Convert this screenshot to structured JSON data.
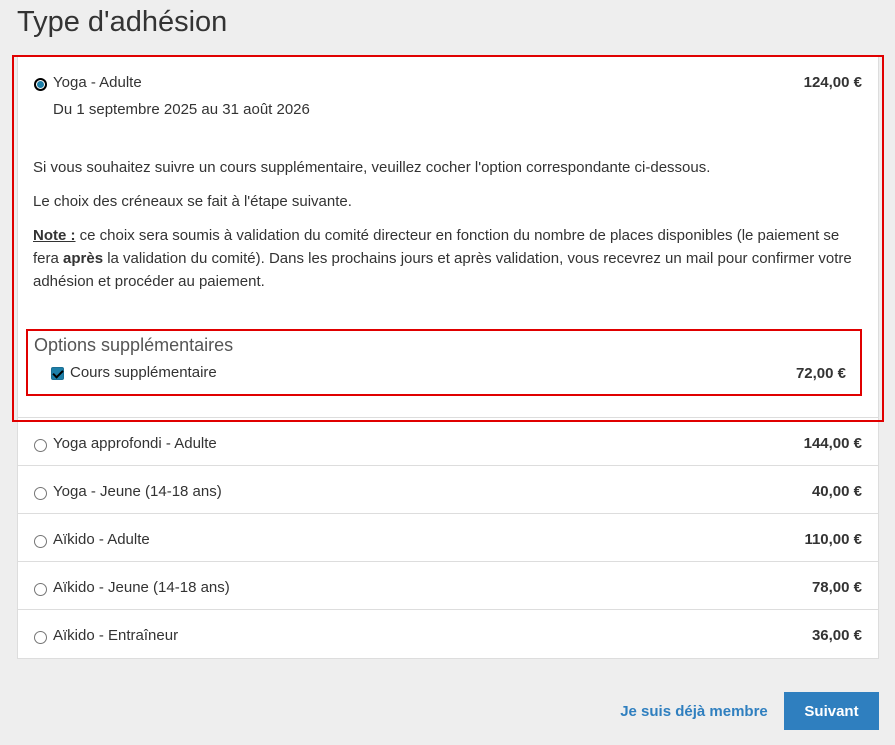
{
  "page": {
    "title": "Type d'adhésion"
  },
  "memberships": [
    {
      "label": "Yoga - Adulte",
      "price": "124,00 €",
      "selected": true,
      "dates": "Du 1 septembre 2025 au 31 août 2026",
      "description": {
        "line1": "Si vous souhaitez suivre un cours supplémentaire, veuillez cocher l'option correspondante ci-dessous.",
        "line2": "Le choix des créneaux se fait à l'étape suivante.",
        "note_label": "Note :",
        "note_text_1": " ce choix sera soumis à validation du comité directeur en fonction du nombre de places disponibles (le paiement se fera ",
        "note_bold": "après",
        "note_text_2": " la validation du comité). Dans les prochains jours et après validation, vous recevrez un mail pour confirmer votre adhésion et procéder au paiement."
      },
      "options": {
        "title": "Options supplémentaires",
        "items": [
          {
            "label": "Cours supplémentaire",
            "price": "72,00 €",
            "checked": true
          }
        ]
      }
    },
    {
      "label": "Yoga approfondi - Adulte",
      "price": "144,00 €",
      "selected": false
    },
    {
      "label": "Yoga - Jeune (14-18 ans)",
      "price": "40,00 €",
      "selected": false
    },
    {
      "label": "Aïkido - Adulte",
      "price": "110,00 €",
      "selected": false
    },
    {
      "label": "Aïkido - Jeune (14-18 ans)",
      "price": "78,00 €",
      "selected": false
    },
    {
      "label": "Aïkido - Entraîneur",
      "price": "36,00 €",
      "selected": false
    }
  ],
  "actions": {
    "member_link": "Je suis déjà membre",
    "next_button": "Suivant"
  },
  "colors": {
    "accent": "#2f7fbf",
    "highlight": "#e00000",
    "radio_checked": "#1d7fa8"
  }
}
